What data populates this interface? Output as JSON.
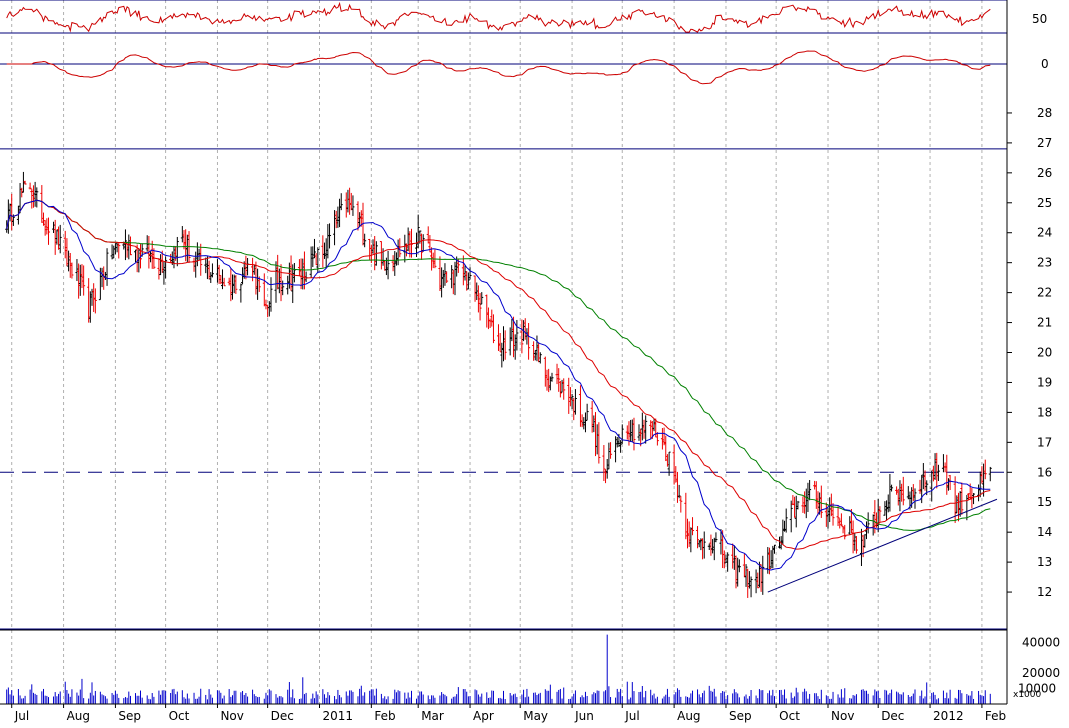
{
  "chart_data": {
    "type": "candlestick",
    "colors": {
      "price": "#ee0000",
      "ma_short": "#0000cc",
      "ma_mid": "#dd0000",
      "ma_long": "#008000",
      "volume": "#0000cc",
      "indicator_line": "#cc0000",
      "reference_lines": "#00007a",
      "grid": "#b0b0b0"
    },
    "panels": [
      {
        "name": "oscillator",
        "ylim": [
          35,
          70
        ],
        "ticks": [
          {
            "value": 50,
            "label": "50"
          }
        ],
        "levels": [
          70,
          35
        ]
      },
      {
        "name": "momentum",
        "ylim": [
          -2,
          2
        ],
        "ticks": [
          {
            "value": 0,
            "label": "0"
          }
        ],
        "levels": [
          0
        ]
      },
      {
        "name": "price",
        "scale": "linear",
        "ylim": [
          10.8,
          28.9
        ],
        "ticks": [
          "12",
          "13",
          "14",
          "15",
          "16",
          "17",
          "18",
          "19",
          "20",
          "21",
          "22",
          "23",
          "24",
          "25",
          "26",
          "27",
          "28"
        ],
        "resistance_level": 16,
        "upper_level": 26.8,
        "trendline": {
          "start": {
            "x": "2011-09-26",
            "y": 12.0
          },
          "end": {
            "x": "2012-02-10",
            "y": 15.1
          }
        }
      },
      {
        "name": "volume",
        "ylim": [
          0,
          48000
        ],
        "unit_label": "x1000",
        "ticks": [
          "20000",
          "40000"
        ],
        "overlapping_tick": "10000"
      }
    ],
    "x_labels": [
      "Jul",
      "Aug",
      "Sep",
      "Oct",
      "Nov",
      "Dec",
      "2011",
      "Feb",
      "Mar",
      "Apr",
      "May",
      "Jun",
      "Jul",
      "Aug",
      "Sep",
      "Oct",
      "Nov",
      "Dec",
      "2012",
      "Feb"
    ],
    "series": [
      {
        "name": "close",
        "points": [
          [
            "2010-06-28",
            24.4
          ],
          [
            "2010-07-05",
            25.2
          ],
          [
            "2010-07-12",
            25.6
          ],
          [
            "2010-07-19",
            24.6
          ],
          [
            "2010-07-26",
            24.0
          ],
          [
            "2010-08-02",
            23.2
          ],
          [
            "2010-08-09",
            22.5
          ],
          [
            "2010-08-16",
            21.5
          ],
          [
            "2010-08-23",
            22.4
          ],
          [
            "2010-08-30",
            23.4
          ],
          [
            "2010-09-06",
            23.7
          ],
          [
            "2010-09-13",
            23.4
          ],
          [
            "2010-09-20",
            23.3
          ],
          [
            "2010-09-27",
            23.0
          ],
          [
            "2010-10-04",
            23.2
          ],
          [
            "2010-10-11",
            23.8
          ],
          [
            "2010-10-18",
            23.1
          ],
          [
            "2010-10-25",
            22.8
          ],
          [
            "2010-11-01",
            22.6
          ],
          [
            "2010-11-08",
            22.2
          ],
          [
            "2010-11-15",
            22.6
          ],
          [
            "2010-11-22",
            23.0
          ],
          [
            "2010-11-29",
            21.3
          ],
          [
            "2010-12-06",
            22.4
          ],
          [
            "2010-12-13",
            22.5
          ],
          [
            "2010-12-20",
            22.6
          ],
          [
            "2010-12-27",
            23.0
          ],
          [
            "2011-01-03",
            23.3
          ],
          [
            "2011-01-10",
            24.2
          ],
          [
            "2011-01-17",
            25.0
          ],
          [
            "2011-01-24",
            24.5
          ],
          [
            "2011-01-31",
            23.6
          ],
          [
            "2011-02-07",
            23.0
          ],
          [
            "2011-02-14",
            23.2
          ],
          [
            "2011-02-21",
            23.6
          ],
          [
            "2011-02-28",
            23.9
          ],
          [
            "2011-03-07",
            23.4
          ],
          [
            "2011-03-14",
            22.4
          ],
          [
            "2011-03-21",
            22.6
          ],
          [
            "2011-03-28",
            22.7
          ],
          [
            "2011-04-04",
            22.0
          ],
          [
            "2011-04-11",
            21.2
          ],
          [
            "2011-04-18",
            20.2
          ],
          [
            "2011-04-25",
            20.4
          ],
          [
            "2011-05-02",
            20.6
          ],
          [
            "2011-05-09",
            20.2
          ],
          [
            "2011-05-16",
            19.3
          ],
          [
            "2011-05-23",
            19.0
          ],
          [
            "2011-05-30",
            18.6
          ],
          [
            "2011-06-06",
            17.9
          ],
          [
            "2011-06-13",
            17.7
          ],
          [
            "2011-06-20",
            15.9
          ],
          [
            "2011-06-27",
            17.0
          ],
          [
            "2011-07-04",
            17.6
          ],
          [
            "2011-07-11",
            17.3
          ],
          [
            "2011-07-18",
            17.6
          ],
          [
            "2011-07-25",
            17.0
          ],
          [
            "2011-08-01",
            16.0
          ],
          [
            "2011-08-08",
            14.2
          ],
          [
            "2011-08-15",
            13.6
          ],
          [
            "2011-08-22",
            13.8
          ],
          [
            "2011-08-29",
            13.4
          ],
          [
            "2011-09-05",
            12.8
          ],
          [
            "2011-09-12",
            12.6
          ],
          [
            "2011-09-19",
            12.3
          ],
          [
            "2011-09-26",
            13.0
          ],
          [
            "2011-10-03",
            13.6
          ],
          [
            "2011-10-10",
            14.6
          ],
          [
            "2011-10-17",
            15.1
          ],
          [
            "2011-10-24",
            15.2
          ],
          [
            "2011-10-31",
            14.8
          ],
          [
            "2011-11-07",
            14.4
          ],
          [
            "2011-11-14",
            14.0
          ],
          [
            "2011-11-21",
            13.5
          ],
          [
            "2011-11-28",
            14.4
          ],
          [
            "2011-12-05",
            15.0
          ],
          [
            "2011-12-12",
            15.4
          ],
          [
            "2011-12-19",
            15.2
          ],
          [
            "2011-12-26",
            15.7
          ],
          [
            "2012-01-02",
            15.9
          ],
          [
            "2012-01-09",
            16.3
          ],
          [
            "2012-01-16",
            14.9
          ],
          [
            "2012-01-23",
            15.2
          ],
          [
            "2012-01-30",
            15.5
          ],
          [
            "2012-02-06",
            16.0
          ]
        ]
      }
    ]
  }
}
